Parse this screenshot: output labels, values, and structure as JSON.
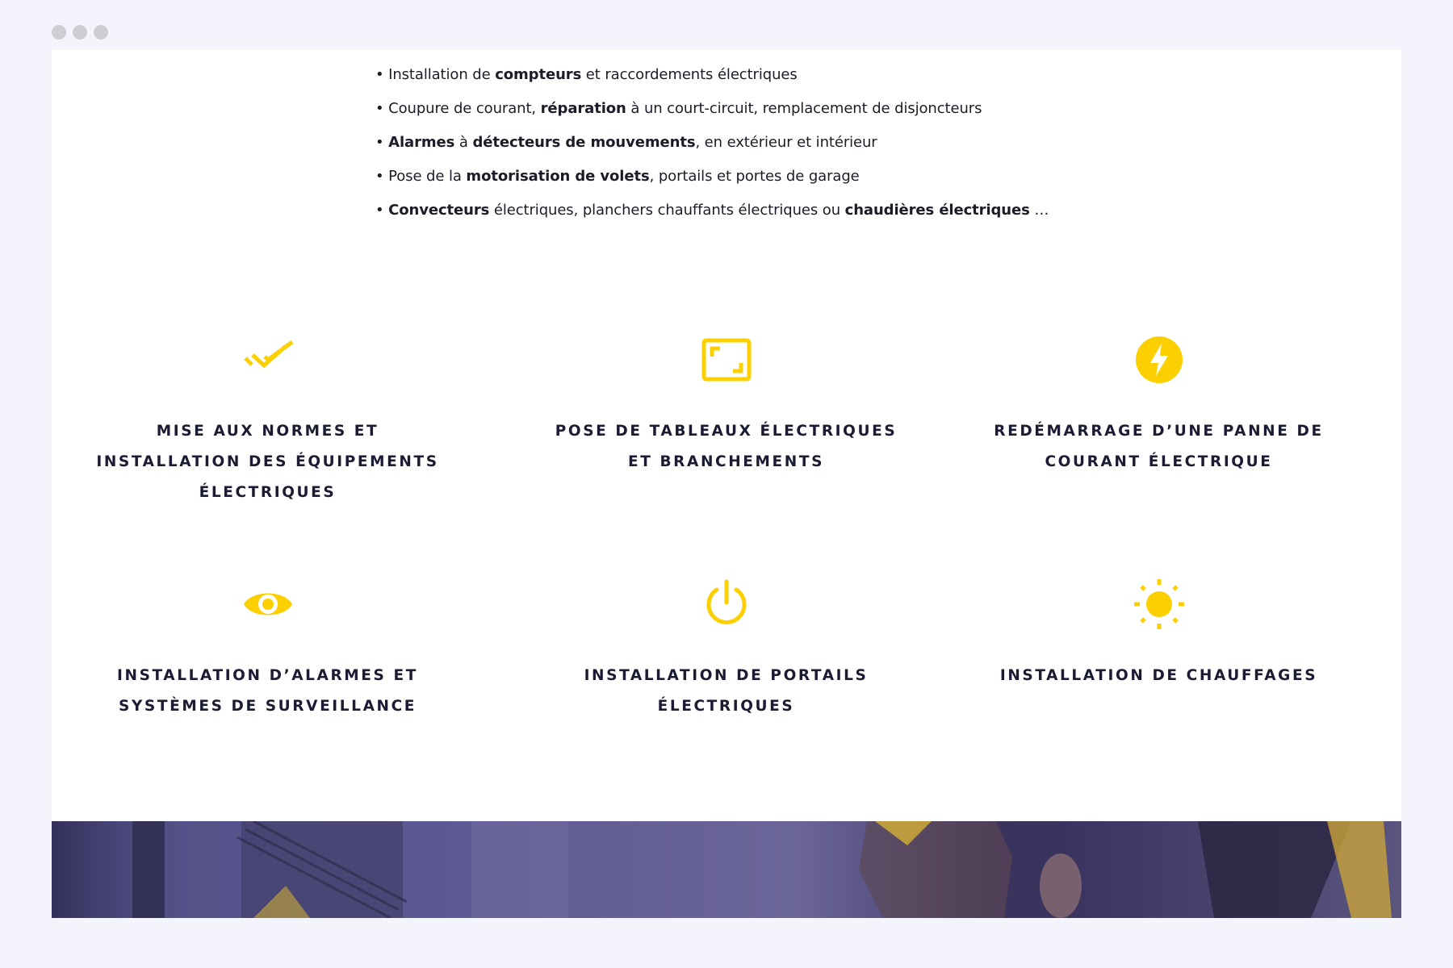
{
  "bullets": [
    {
      "segments": [
        {
          "text": "• Installation de ",
          "bold": false
        },
        {
          "text": "compteurs",
          "bold": true
        },
        {
          "text": " et raccordements électriques",
          "bold": false
        }
      ]
    },
    {
      "segments": [
        {
          "text": "• Coupure de courant, ",
          "bold": false
        },
        {
          "text": "réparation",
          "bold": true
        },
        {
          "text": " à un court-circuit, remplacement de disjoncteurs",
          "bold": false
        }
      ]
    },
    {
      "segments": [
        {
          "text": "• ",
          "bold": false
        },
        {
          "text": "Alarmes",
          "bold": true
        },
        {
          "text": " à ",
          "bold": false
        },
        {
          "text": "détecteurs de mouvements",
          "bold": true
        },
        {
          "text": ", en extérieur et intérieur",
          "bold": false
        }
      ]
    },
    {
      "segments": [
        {
          "text": "• Pose de la ",
          "bold": false
        },
        {
          "text": "motorisation de volets",
          "bold": true
        },
        {
          "text": ", portails et portes de garage",
          "bold": false
        }
      ]
    },
    {
      "segments": [
        {
          "text": "• ",
          "bold": false
        },
        {
          "text": "Convecteurs",
          "bold": true
        },
        {
          "text": " électriques, planchers chauffants électriques ou ",
          "bold": false
        },
        {
          "text": "chaudières électriques",
          "bold": true
        },
        {
          "text": " …",
          "bold": false
        }
      ]
    }
  ],
  "services": [
    {
      "icon": "double-check-icon",
      "title": "MISE AUX NORMES ET INSTALLATION DES ÉQUIPEMENTS ÉLECTRIQUES"
    },
    {
      "icon": "frame-icon",
      "title": "POSE DE TABLEAUX ÉLECTRIQUES ET BRANCHEMENTS"
    },
    {
      "icon": "lightning-icon",
      "title": "REDÉMARRAGE D’UNE PANNE DE COURANT ÉLECTRIQUE"
    },
    {
      "icon": "eye-icon",
      "title": "INSTALLATION D’ALARMES ET SYSTÈMES DE SURVEILLANCE"
    },
    {
      "icon": "power-icon",
      "title": "INSTALLATION DE PORTAILS ÉLECTRIQUES"
    },
    {
      "icon": "sun-icon",
      "title": "INSTALLATION DE CHAUFFAGES"
    }
  ],
  "colors": {
    "accent": "#fcd000",
    "heading": "#1b1b33",
    "text": "#1c1c28",
    "background": "#f4f4fc"
  }
}
